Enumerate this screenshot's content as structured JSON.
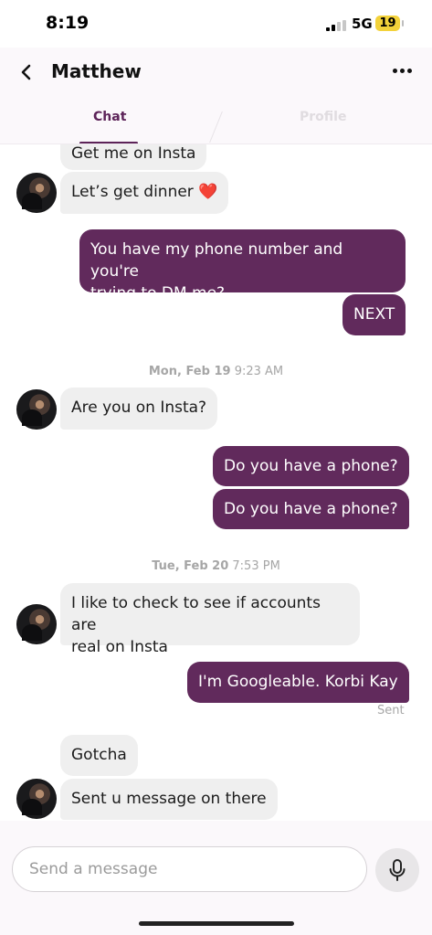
{
  "status_bar": {
    "time": "8:19",
    "network": "5G",
    "battery": "19"
  },
  "header": {
    "title": "Matthew",
    "tabs": [
      {
        "label": "Chat",
        "active": true
      },
      {
        "label": "Profile",
        "active": false
      }
    ]
  },
  "messages": [
    {
      "side": "in",
      "text": "Get me on Insta"
    },
    {
      "side": "in",
      "text": "Let’s get dinner ❤️"
    },
    {
      "side": "out",
      "lines": [
        "You have my phone number and you're",
        "trying to DM me?"
      ]
    },
    {
      "side": "out",
      "text": "NEXT"
    },
    {
      "side": "divider",
      "day": "Mon, Feb 19",
      "time": "9:23 AM"
    },
    {
      "side": "in",
      "text": "Are you on Insta?"
    },
    {
      "side": "out",
      "text": "Do you have a phone?"
    },
    {
      "side": "out",
      "text": "Do you have a phone?"
    },
    {
      "side": "divider",
      "day": "Tue, Feb 20",
      "time": "7:53 PM"
    },
    {
      "side": "in",
      "lines": [
        "I like to check to see if accounts are",
        "real on Insta"
      ]
    },
    {
      "side": "out",
      "text": "I'm Googleable. Korbi Kay",
      "status": "Sent"
    },
    {
      "side": "in",
      "text": "Gotcha"
    },
    {
      "side": "in",
      "text": "Sent u message on there"
    }
  ],
  "composer": {
    "placeholder": "Send a message"
  },
  "colors": {
    "accent": "#612a5c",
    "incoming": "#efefef",
    "battery": "#f3d23a"
  },
  "icons": [
    "back-chevron-icon",
    "more-dots-icon",
    "microphone-icon"
  ]
}
